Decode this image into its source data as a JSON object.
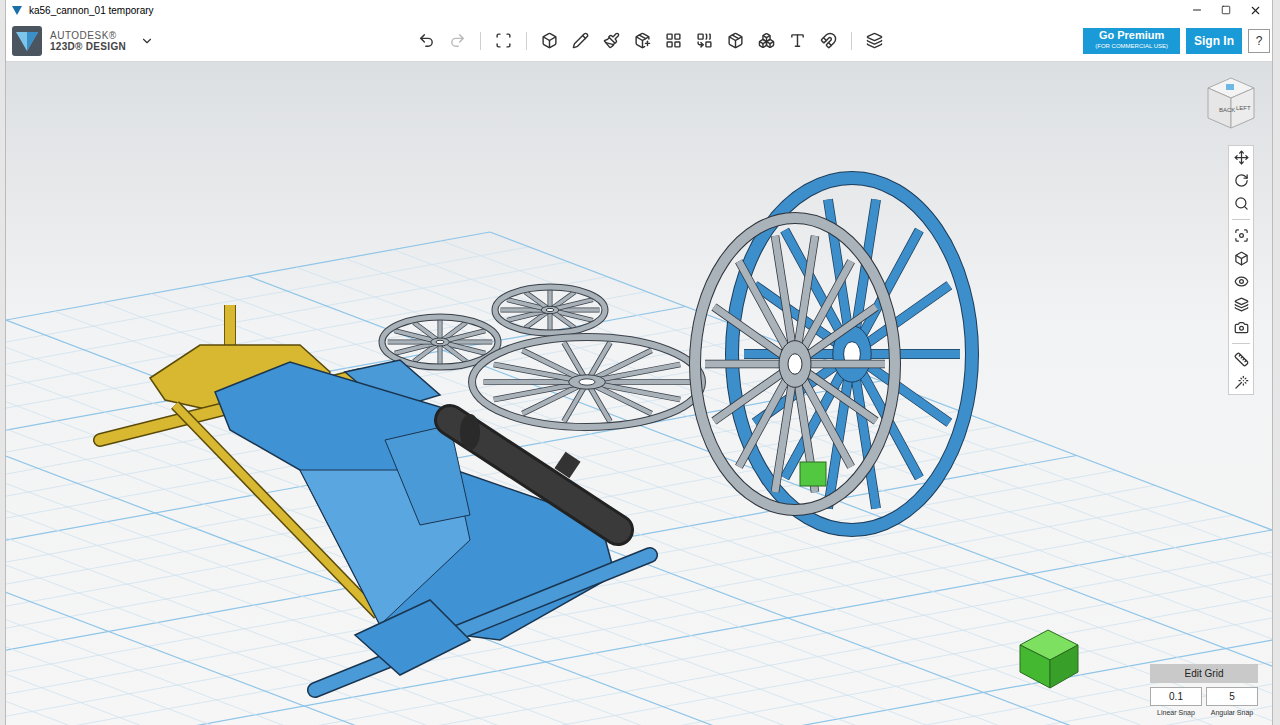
{
  "window": {
    "title": "ka56_cannon_01 temporary"
  },
  "app": {
    "brand_top": "AUTODESK®",
    "brand_bottom": "123D® DESIGN"
  },
  "premium": {
    "label": "Go Premium",
    "sublabel": "(FOR COMMERCIAL USE)"
  },
  "sign_in": "Sign In",
  "help": "?",
  "view_cube": {
    "faces": [
      "BACK",
      "LEFT"
    ]
  },
  "grid_panel": {
    "title": "Edit Grid",
    "fields": [
      {
        "value": "0.1",
        "label": "Linear Snap"
      },
      {
        "value": "5",
        "label": "Angular Snap"
      }
    ]
  }
}
